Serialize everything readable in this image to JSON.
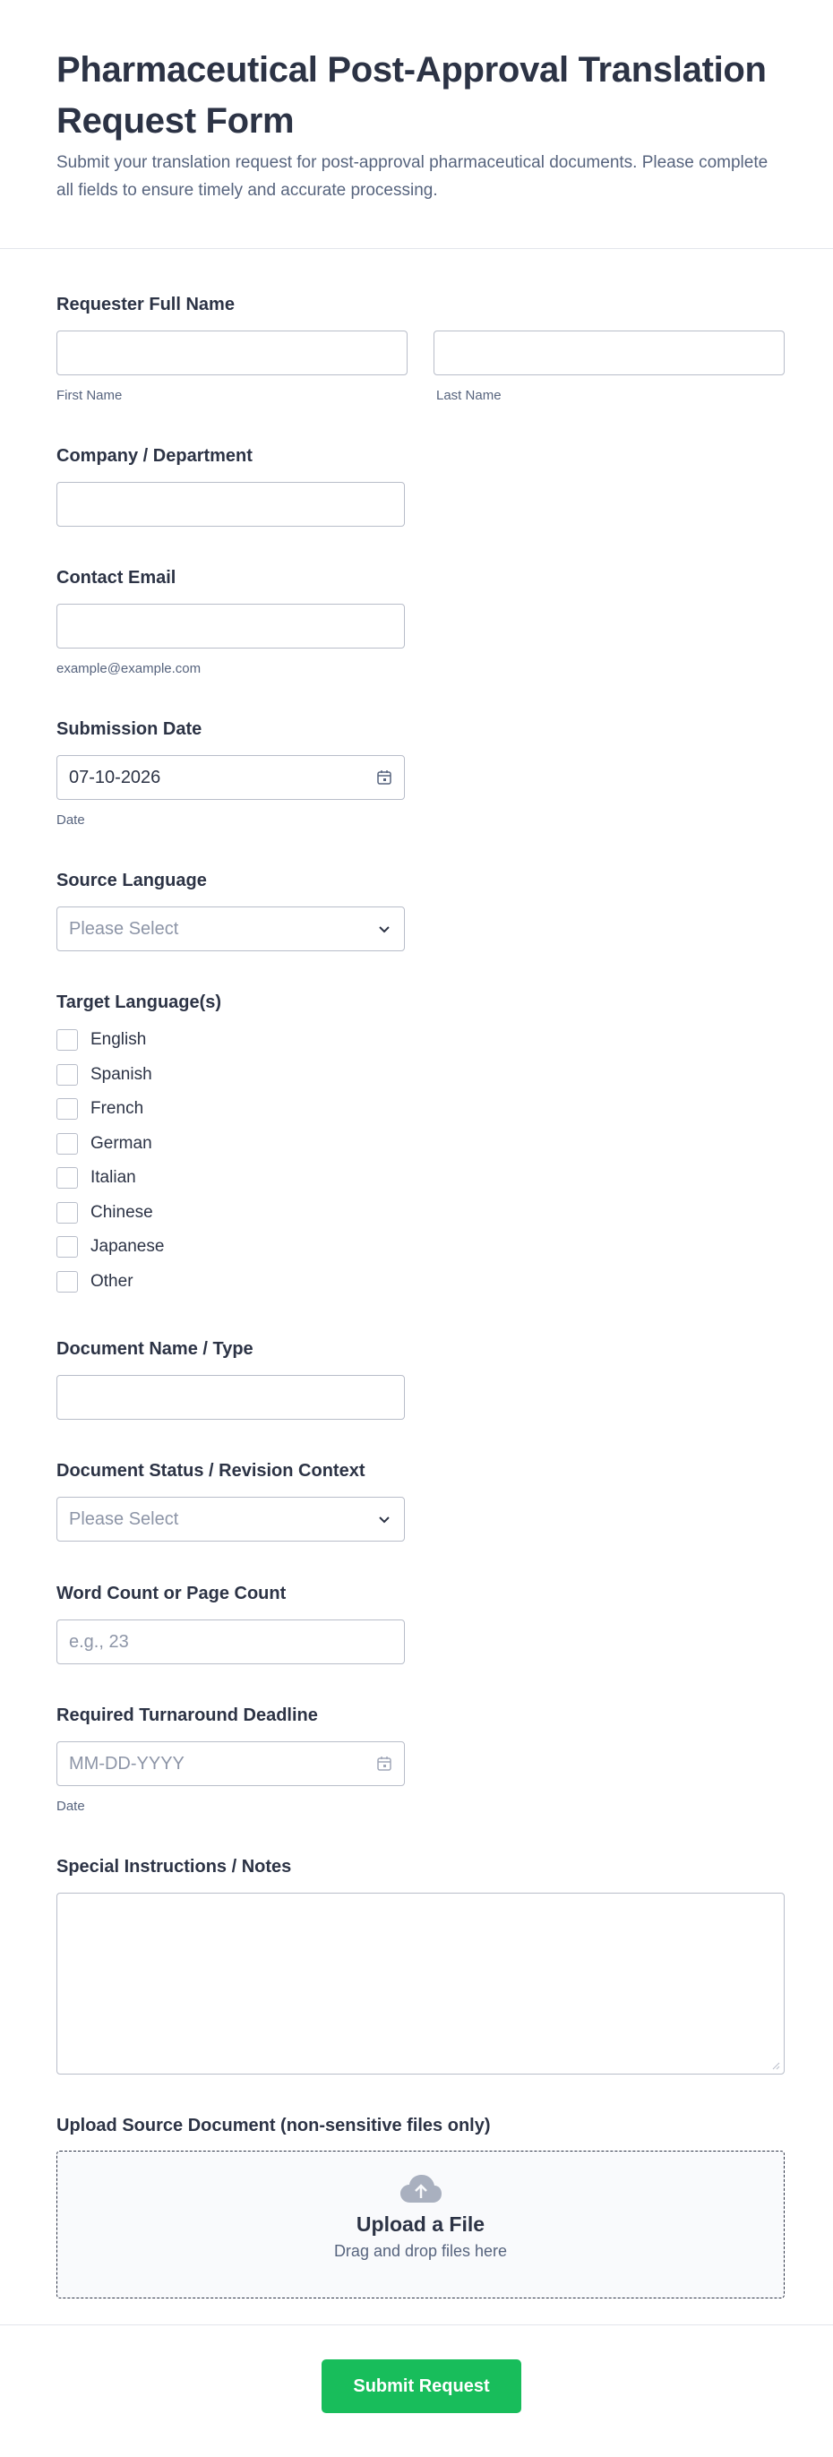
{
  "header": {
    "title": "Pharmaceutical Post-Approval Translation Request Form",
    "description": "Submit your translation request for post-approval pharmaceutical documents. Please complete all fields to ensure timely and accurate processing."
  },
  "fields": {
    "full_name": {
      "label": "Requester Full Name",
      "first_sub": "First Name",
      "last_sub": "Last Name",
      "first_value": "",
      "last_value": ""
    },
    "company": {
      "label": "Company / Department",
      "value": ""
    },
    "email": {
      "label": "Contact Email",
      "sub": "example@example.com",
      "value": ""
    },
    "submission_date": {
      "label": "Submission Date",
      "value": "07-10-2026",
      "sub": "Date",
      "icon": "calendar-icon"
    },
    "source_language": {
      "label": "Source Language",
      "placeholder": "Please Select",
      "icon": "chevron-down-icon"
    },
    "target_languages": {
      "label": "Target Language(s)",
      "options": [
        "English",
        "Spanish",
        "French",
        "German",
        "Italian",
        "Chinese",
        "Japanese",
        "Other"
      ]
    },
    "document_name": {
      "label": "Document Name / Type",
      "value": ""
    },
    "document_status": {
      "label": "Document Status / Revision Context",
      "placeholder": "Please Select",
      "icon": "chevron-down-icon"
    },
    "word_count": {
      "label": "Word Count or Page Count",
      "placeholder": "e.g., 23"
    },
    "deadline": {
      "label": "Required Turnaround Deadline",
      "placeholder": "MM-DD-YYYY",
      "sub": "Date",
      "icon": "calendar-icon"
    },
    "notes": {
      "label": "Special Instructions / Notes",
      "value": ""
    },
    "upload": {
      "label": "Upload Source Document (non-sensitive files only)",
      "title": "Upload a File",
      "sub": "Drag and drop files here",
      "icon": "cloud-upload-icon"
    }
  },
  "submit": {
    "label": "Submit Request",
    "color": "#18bd5b"
  },
  "colors": {
    "text": "#2c3345",
    "muted": "#57647e",
    "border": "#b8bdc9",
    "placeholder": "#8d95a7"
  }
}
